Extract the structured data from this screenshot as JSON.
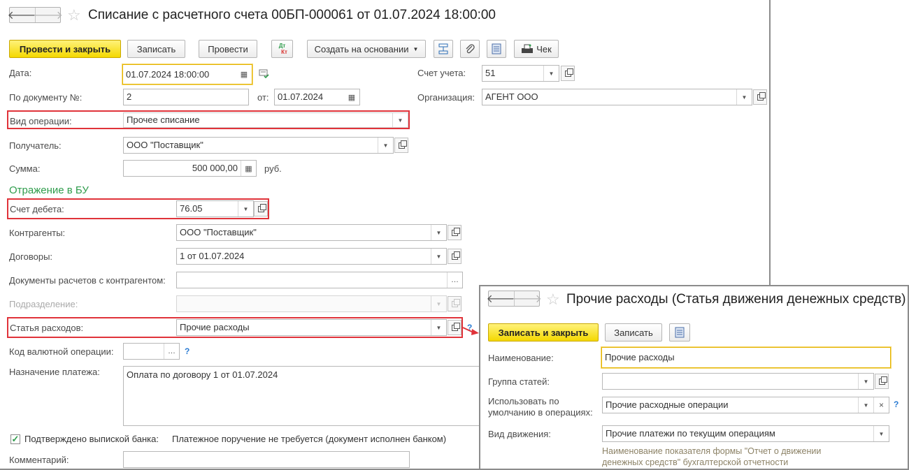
{
  "main": {
    "title": "Списание с расчетного счета 00БП-000061 от 01.07.2024 18:00:00",
    "nav": {
      "back": "🡐",
      "forward": "🡒"
    },
    "toolbar": {
      "post_close": "Провести и закрыть",
      "save": "Записать",
      "post": "Провести",
      "dtkt_top": "Дт",
      "dtkt_bottom": "Кт",
      "create_based": "Создать на основании",
      "check": "Чек"
    },
    "form": {
      "date_label": "Дата:",
      "date_value": "01.07.2024 18:00:00",
      "docnum_label": "По документу №:",
      "docnum_value": "2",
      "from_label": "от:",
      "from_value": "01.07.2024",
      "optype_label": "Вид операции:",
      "optype_value": "Прочее списание",
      "recipient_label": "Получатель:",
      "recipient_value": "ООО \"Поставщик\"",
      "amount_label": "Сумма:",
      "amount_value": "500 000,00",
      "currency": "руб.",
      "account_label": "Счет учета:",
      "account_value": "51",
      "org_label": "Организация:",
      "org_value": "АГЕНТ ООО",
      "section_bu": "Отражение в БУ",
      "debit_label": "Счет дебета:",
      "debit_value": "76.05",
      "counterparty_label": "Контрагенты:",
      "counterparty_value": "ООО \"Поставщик\"",
      "contracts_label": "Договоры:",
      "contracts_value": "1 от 01.07.2024",
      "settle_docs_label": "Документы расчетов с контрагентом:",
      "settle_docs_value": "",
      "division_label": "Подразделение:",
      "division_value": "",
      "expense_label": "Статья расходов:",
      "expense_value": "Прочие расходы",
      "currency_op_label": "Код валютной операции:",
      "currency_op_value": "",
      "purpose_label": "Назначение платежа:",
      "purpose_value": "Оплата по договору 1 от 01.07.2024",
      "confirmed_label": "Подтверждено выпиской банка:",
      "confirmed_note": "Платежное поручение не требуется (документ исполнен банком)",
      "comment_label": "Комментарий:",
      "comment_value": ""
    }
  },
  "popup": {
    "title": "Прочие расходы (Статья движения денежных средств)",
    "nav": {
      "back": "🡐",
      "forward": "🡒"
    },
    "toolbar": {
      "save_close": "Записать и закрыть",
      "save": "Записать"
    },
    "form": {
      "name_label": "Наименование:",
      "name_value": "Прочие расходы",
      "group_label": "Группа статей:",
      "group_value": "",
      "default_label_1": "Использовать по",
      "default_label_2": "умолчанию в операциях:",
      "default_value": "Прочие расходные операции",
      "movement_label": "Вид движения:",
      "movement_value": "Прочие платежи по текущим операциям",
      "movement_note": "Наименование показателя формы \"Отчет о движении денежных средств\" бухгалтерской отчетности"
    }
  },
  "colors": {
    "primary_button": "#f4d800",
    "highlight": "#e0333a",
    "section": "#2e9c4b",
    "help": "#2a7bd3"
  }
}
